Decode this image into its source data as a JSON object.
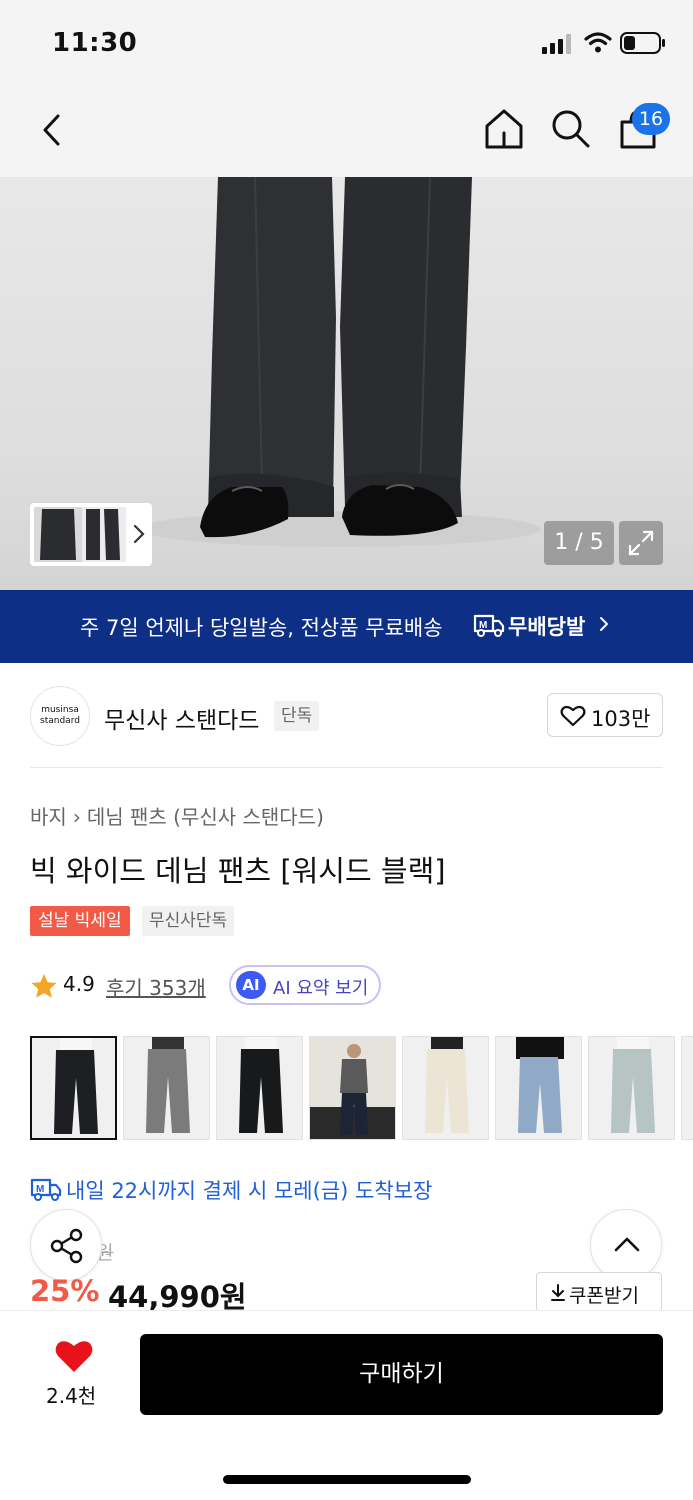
{
  "status_bar": {
    "time": "11:30"
  },
  "header": {
    "cart_count": "16"
  },
  "gallery": {
    "counter": "1 / 5"
  },
  "banner": {
    "text": "주 7일 언제나 당일발송, 전상품 무료배송",
    "brand": "무배당발"
  },
  "brand": {
    "logo_line1": "musinsa",
    "logo_line2": "standard",
    "name": "무신사 스탠다드",
    "badge": "단독",
    "likes": "103만"
  },
  "breadcrumb": {
    "items": [
      "바지",
      "데님 팬츠 (무신사 스탠다드)"
    ]
  },
  "product": {
    "title": "빅 와이드 데님 팬츠 [워시드 블랙]",
    "tags": [
      "설날 빅세일",
      "무신사단독"
    ],
    "rating": "4.9",
    "reviews": "후기 353개",
    "ai_logo": "AI",
    "ai_label": "AI 요약 보기"
  },
  "color_options": [
    "black",
    "gray",
    "black-2",
    "dark-indigo",
    "ecru",
    "light-blue",
    "pale-blue"
  ],
  "delivery": {
    "text": "내일 22시까지 결제 시 모레(금) 도착보장"
  },
  "price": {
    "original": "원",
    "discount": "25%",
    "sale": "44,990원",
    "coupon": "쿠폰받기"
  },
  "bottom_bar": {
    "wishlist_count": "2.4천",
    "buy_label": "구매하기"
  },
  "colors": {
    "banner_bg": "#0e2f86",
    "sale_red": "#f05a46",
    "link_blue": "#1f5fd8",
    "badge_blue": "#1a73e8",
    "ai_purple": "#4b43c2"
  }
}
